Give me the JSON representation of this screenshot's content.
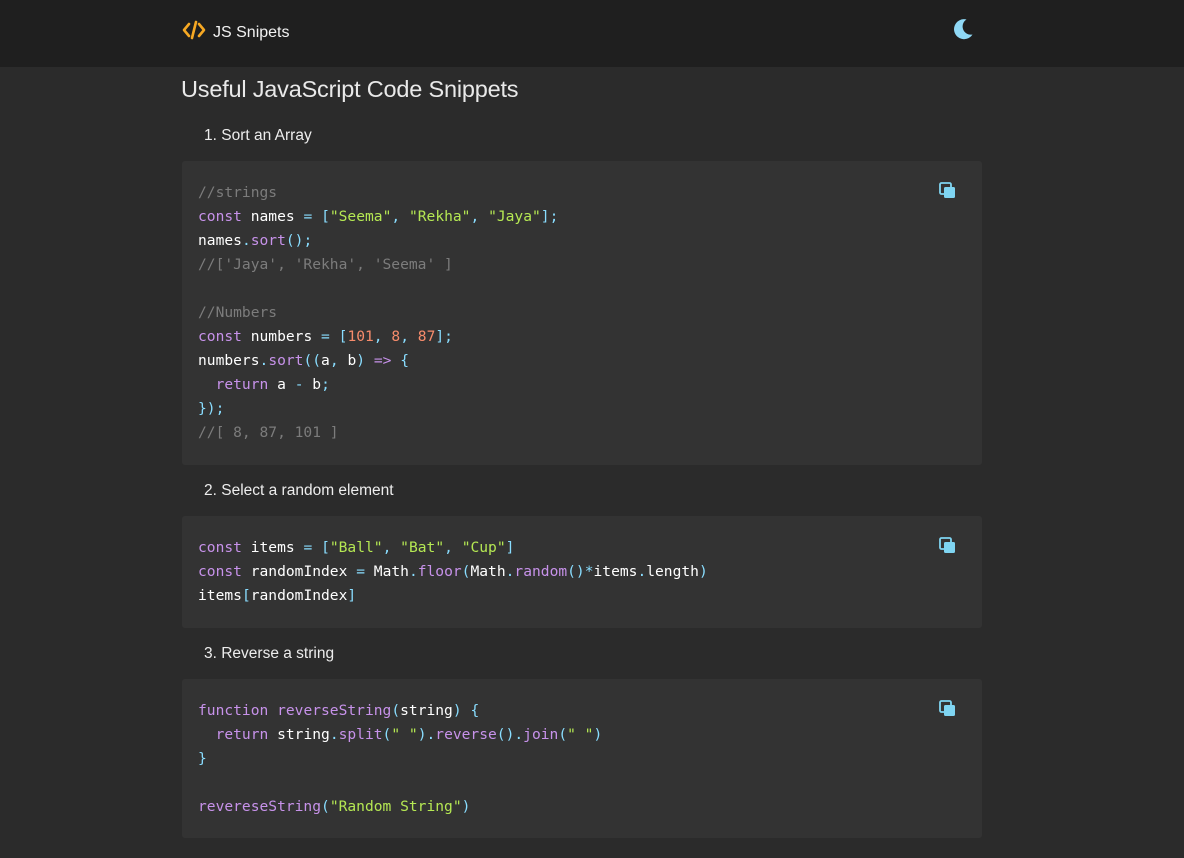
{
  "navbar": {
    "brand_title": "JS Snipets",
    "brand_icon": "code-icon",
    "theme_icon": "moon-icon",
    "brand_color": "#f6a823",
    "theme_icon_color": "#8fd8f5"
  },
  "page": {
    "title": "Useful JavaScript Code Snippets"
  },
  "snippets": [
    {
      "heading": "1. Sort an Array",
      "copy_icon": "copy-icon",
      "code": [
        "//strings",
        "const names = [\"Seema\", \"Rekha\", \"Jaya\"];",
        "names.sort();",
        "//['Jaya', 'Rekha', 'Seema' ]",
        "",
        "//Numbers",
        "const numbers = [101, 8, 87];",
        "numbers.sort((a, b) => {",
        "  return a - b;",
        "});",
        "//[ 8, 87, 101 ]"
      ]
    },
    {
      "heading": "2. Select a random element",
      "copy_icon": "copy-icon",
      "code": [
        "const items = [\"Ball\", \"Bat\", \"Cup\"]",
        "const randomIndex = Math.floor(Math.random()*items.length)",
        "items[randomIndex]"
      ]
    },
    {
      "heading": "3. Reverse a string",
      "copy_icon": "copy-icon",
      "code": [
        "function reverseString(string) {",
        "  return string.split(\" \").reverse().join(\" \")",
        "}",
        "",
        "revereseString(\"Random String\")"
      ]
    }
  ],
  "colors": {
    "page_bg": "#2b2b2b",
    "navbar_bg": "#1f1f1f",
    "code_bg": "#333333",
    "comment": "#7c7c7c",
    "keyword": "#c792ea",
    "string": "#b5e853",
    "number": "#f78c6c",
    "punctuation": "#89ddff",
    "copy_icon": "#7fd5f2"
  }
}
